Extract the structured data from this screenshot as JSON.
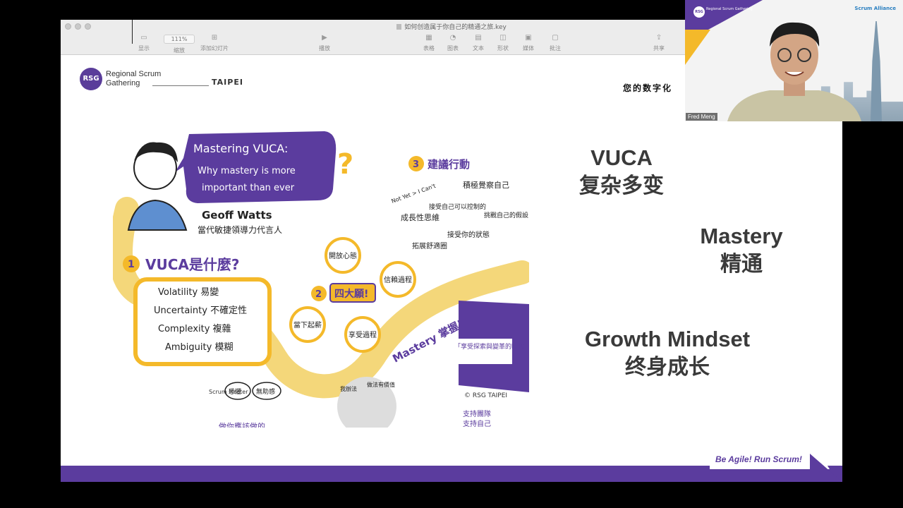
{
  "keynote": {
    "doc_title": "如何创造属于你自己的精通之旅.key",
    "zoom": "111%",
    "toolbar": [
      {
        "label": "显示",
        "icon": "sidebar-icon"
      },
      {
        "label": "缩放",
        "icon": "zoom-icon"
      },
      {
        "label": "添加幻灯片",
        "icon": "add-slide-icon"
      },
      {
        "label": "播放",
        "icon": "play-icon"
      },
      {
        "label": "表格",
        "icon": "table-icon"
      },
      {
        "label": "图表",
        "icon": "chart-icon"
      },
      {
        "label": "文本",
        "icon": "text-icon"
      },
      {
        "label": "形状",
        "icon": "shape-icon"
      },
      {
        "label": "媒体",
        "icon": "media-icon"
      },
      {
        "label": "批注",
        "icon": "comment-icon"
      },
      {
        "label": "共享",
        "icon": "share-icon"
      }
    ]
  },
  "slide": {
    "logo_text": "RSG",
    "org_line1": "Regional Scrum",
    "org_line2": "Gathering",
    "org_city": "TAIPEI",
    "top_right_text": "您的数字化",
    "topics": [
      {
        "en": "VUCA",
        "zh": "复杂多变"
      },
      {
        "en": "Mastery",
        "zh": "精通"
      },
      {
        "en": "Growth Mindset",
        "zh": "终身成长"
      }
    ],
    "footer_slogan": "Be Agile! Run Scrum!",
    "colors": {
      "purple": "#5b3c9e",
      "yellow": "#f4b92a"
    }
  },
  "sketch": {
    "title_line1": "Mastering VUCA:",
    "title_line2": "Why mastery is more",
    "title_line3": "important than ever",
    "speaker_name": "Geoff Watts",
    "speaker_role": "當代敏捷領導力代言人",
    "section1_num": "1",
    "section1_title": "VUCA是什麼?",
    "vuca_items": [
      "Volatility 易變",
      "Uncertainty 不確定性",
      "Complexity 複雜",
      "Ambiguity 模糊"
    ],
    "section2_num": "2",
    "section2_title": "四大願!",
    "wishes": [
      "開放心態",
      "信賴過程",
      "當下起薪",
      "享受過程"
    ],
    "section3_num": "3",
    "section3_title": "建議行動",
    "actions": [
      "成長性思維",
      "積極覺察自己",
      "接受自己可以控制的",
      "挑戰自己的假設",
      "拓展舒適圈",
      "接受你的狀態"
    ],
    "not_yet": "Not Yet > I Can't",
    "mastery_label": "Mastery 掌握!!",
    "era_text": "「享受探索與變革的時代」",
    "fear_labels": [
      "恐懼",
      "無助感"
    ],
    "do_text": "做你應該做的",
    "scrum_master": "Scrum Master",
    "dog_labels": [
      "我辦法",
      "做法有價值"
    ],
    "support_lines": [
      "支持團隊",
      "支持自己"
    ],
    "copyright": "© RSG TAIPEI"
  },
  "video": {
    "participant_name": "Fred Meng",
    "rsg_small": "Regional Scrum Gathering",
    "alliance": "Scrum Alliance"
  }
}
